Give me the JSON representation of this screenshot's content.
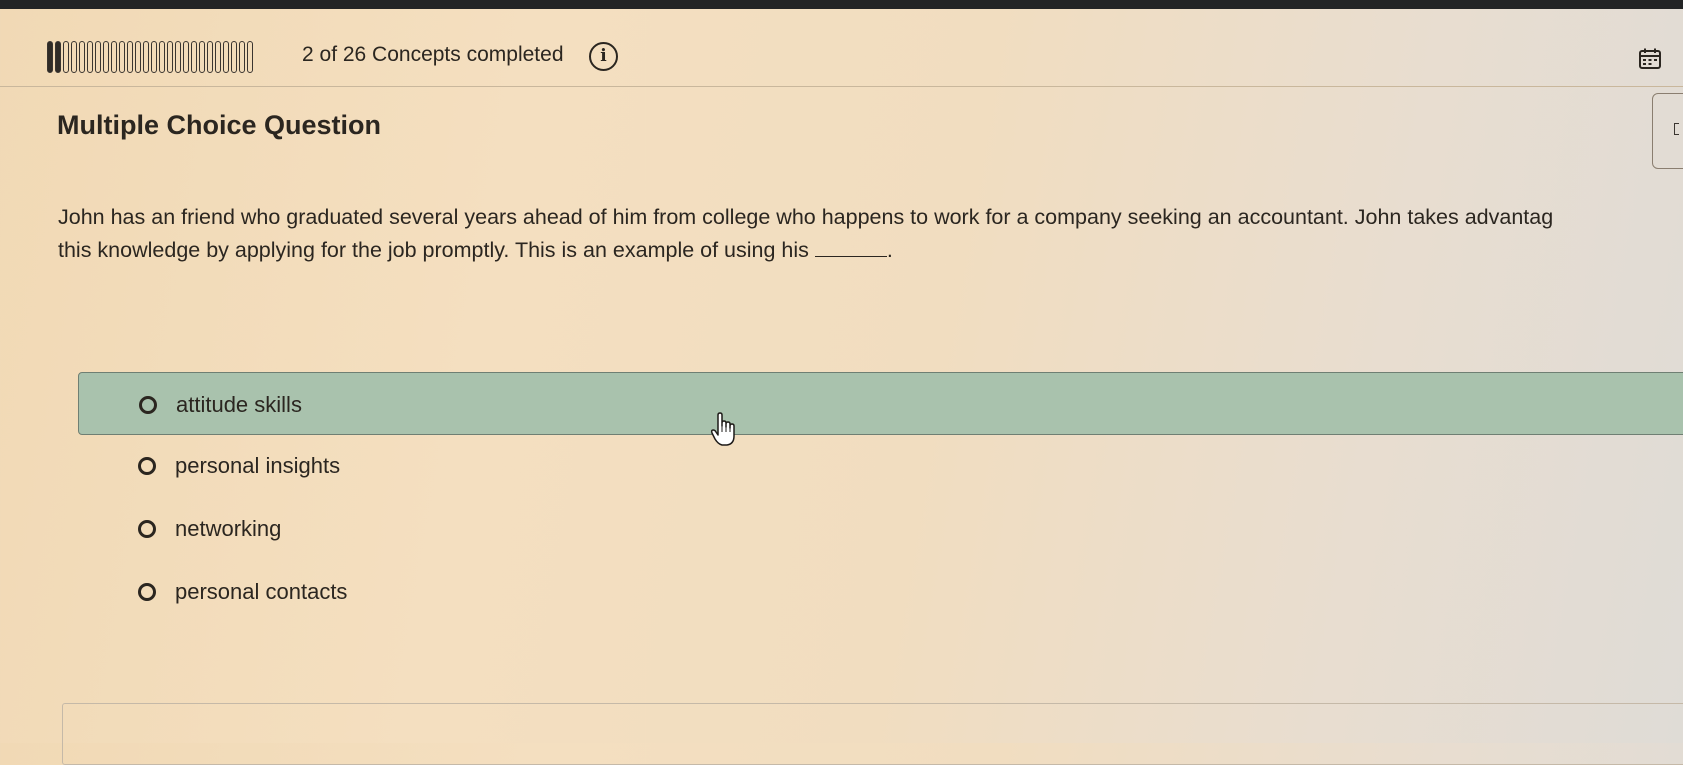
{
  "progress": {
    "completed": 2,
    "total": 26,
    "text": "2 of 26 Concepts completed"
  },
  "icons": {
    "info": "info-icon",
    "calendar": "calendar-icon",
    "cursor": "hand-pointer-cursor"
  },
  "question": {
    "type_label": "Multiple Choice Question",
    "line1": "John has an friend who graduated several years ahead of him from college who happens to work for a company seeking an accountant. John takes advantag",
    "line2": "this knowledge by applying for the job promptly. This is an example of using his",
    "line2_end": "."
  },
  "choices": [
    {
      "label": "attitude skills",
      "highlighted": true
    },
    {
      "label": "personal insights",
      "highlighted": false
    },
    {
      "label": "networking",
      "highlighted": false
    },
    {
      "label": "personal contacts",
      "highlighted": false
    }
  ],
  "colors": {
    "highlight": "#a9c2ad",
    "text": "#2b2620"
  }
}
